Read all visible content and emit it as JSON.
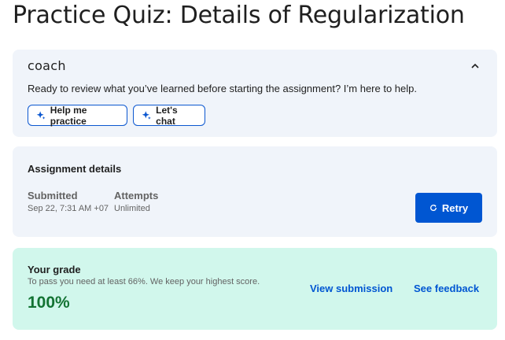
{
  "page": {
    "title": "Practice Quiz: Details of Regularization"
  },
  "coach": {
    "logo_text": "coach",
    "message": "Ready to review what you’ve learned before starting the assignment? I’m here to help.",
    "practice_label": "Help me practice",
    "chat_label": "Let's chat",
    "collapse_icon": "chevron-up-icon",
    "button_icon": "sparkle-icon",
    "accent_color": "#0b57d0"
  },
  "assignment": {
    "heading": "Assignment details",
    "submitted_label": "Submitted",
    "submitted_value": "Sep 22, 7:31 AM +07",
    "attempts_label": "Attempts",
    "attempts_value": "Unlimited",
    "retry_label": "Retry",
    "retry_icon": "refresh-icon",
    "retry_color": "#0056d2"
  },
  "grade": {
    "heading": "Your grade",
    "note": "To pass you need at least 66%. We keep your highest score.",
    "value": "100%",
    "value_color": "#137333",
    "view_submission_label": "View submission",
    "see_feedback_label": "See feedback",
    "card_color": "#d1f7ec"
  }
}
